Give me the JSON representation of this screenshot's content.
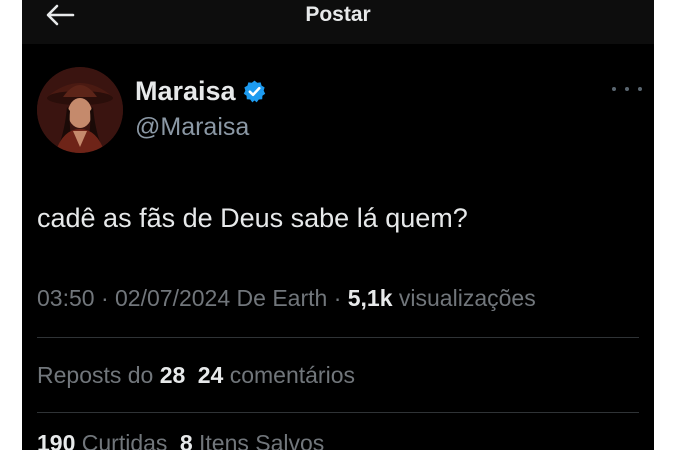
{
  "header": {
    "title": "Postar",
    "back_icon": "arrow-left-icon"
  },
  "author": {
    "name": "Maraisa",
    "handle": "@Maraisa",
    "verified_icon": "verified-badge-icon",
    "verified_color": "#1d9bf0"
  },
  "more_icon": "more-horizontal-icon",
  "post": {
    "text": "cadê as fãs de Deus sabe lá quem?"
  },
  "meta": {
    "time": "03:50",
    "date": "02/07/2024",
    "source": "De Earth",
    "views_count": "5,1k",
    "views_label": "visualizações",
    "separator": "·"
  },
  "stats": {
    "reposts_label": "Reposts do",
    "reposts_count": "28",
    "comments_count": "24",
    "comments_label": "comentários",
    "likes_count": "190",
    "likes_label": "Curtidas",
    "saves_count": "8",
    "saves_label": "Itens Salvos"
  }
}
